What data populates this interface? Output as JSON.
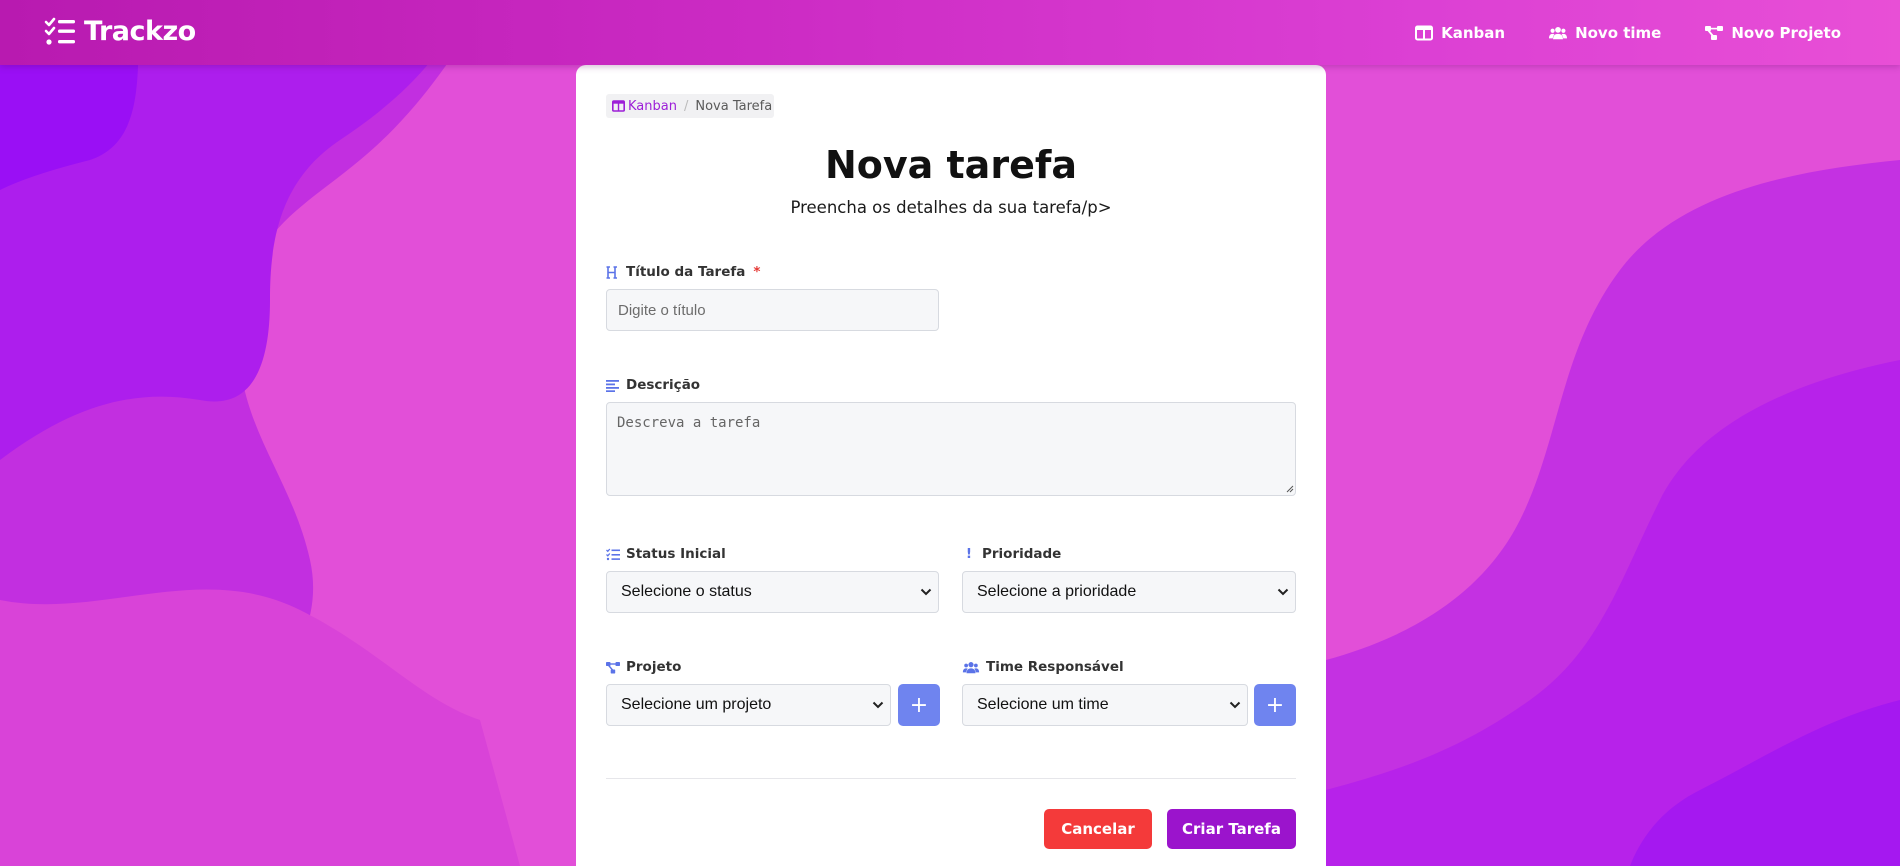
{
  "brand": {
    "name": "Trackzo",
    "icon": "list-check-icon"
  },
  "nav": {
    "links": [
      {
        "label": "Kanban",
        "icon": "kanban-icon"
      },
      {
        "label": "Novo time",
        "icon": "users-icon"
      },
      {
        "label": "Novo Projeto",
        "icon": "project-diagram-icon"
      }
    ]
  },
  "breadcrumb": {
    "link": "Kanban",
    "current": "Nova Tarefa",
    "separator": "/"
  },
  "form": {
    "title": "Nova tarefa",
    "subtitle": "Preencha os detalhes da sua tarefa/p>",
    "titulo": {
      "label": "Título da Tarefa",
      "required": "*",
      "placeholder": "Digite o título",
      "icon": "heading-icon"
    },
    "descricao": {
      "label": "Descrição",
      "placeholder": "Descreva a tarefa",
      "icon": "align-left-icon"
    },
    "status": {
      "label": "Status Inicial",
      "value": "Selecione o status",
      "icon": "tasks-icon"
    },
    "prioridade": {
      "label": "Prioridade",
      "value": "Selecione a prioridade",
      "icon": "exclamation-icon",
      "icon_glyph": "!"
    },
    "projeto": {
      "label": "Projeto",
      "value": "Selecione um projeto",
      "icon": "project-diagram-icon",
      "add": "+"
    },
    "time": {
      "label": "Time Responsável",
      "value": "Selecione um time",
      "icon": "users-icon",
      "add": "+"
    },
    "actions": {
      "cancel": "Cancelar",
      "submit": "Criar Tarefa"
    }
  },
  "colors": {
    "navbar": "#c724be",
    "accent_purple": "#9b14cc",
    "cancel_red": "#f43a3a",
    "icon_blue": "#5b73e8"
  }
}
